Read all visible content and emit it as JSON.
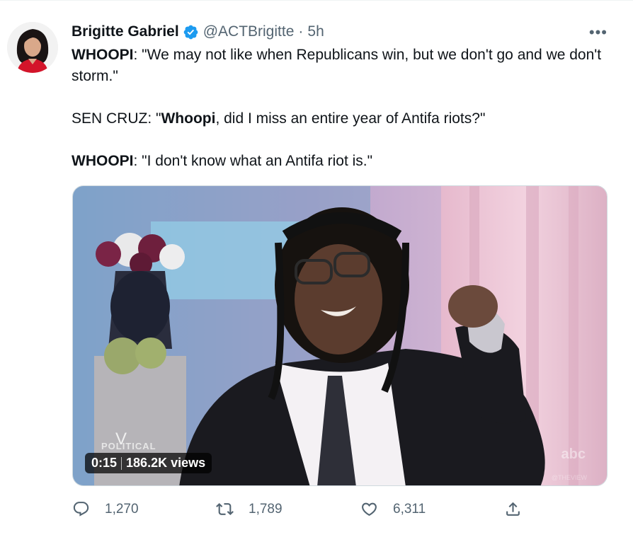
{
  "author": {
    "name": "Brigitte Gabriel",
    "handle": "@ACTBrigitte",
    "separator": "·",
    "time": "5h",
    "verified": true
  },
  "more_menu": "•••",
  "tweet_text": {
    "line1_speaker": "WHOOPI",
    "line1_rest": ": \"We may not like when Republicans win, but we don't go and we don't storm.\"",
    "line2_prefix": "SEN CRUZ: \"",
    "line2_bold": "Whoopi",
    "line2_rest": ", did I miss an entire year of Antifa riots?\"",
    "line3_speaker": "WHOOPI",
    "line3_rest": ": \"I don't know what an Antifa riot is.\""
  },
  "video": {
    "brand_small": "POLITICAL",
    "brand_v": "V",
    "duration": "0:15",
    "views": "186.2K views",
    "network_logo": "abc",
    "network_sub": "@THEVIEW"
  },
  "actions": {
    "reply_count": "1,270",
    "retweet_count": "1,789",
    "like_count": "6,311"
  },
  "icons": {
    "verified": "verified-badge-icon",
    "reply": "reply-icon",
    "retweet": "retweet-icon",
    "like": "heart-icon",
    "share": "share-icon"
  },
  "colors": {
    "verified_blue": "#1d9bf0",
    "secondary_text": "#536471",
    "primary_text": "#0f1419"
  }
}
